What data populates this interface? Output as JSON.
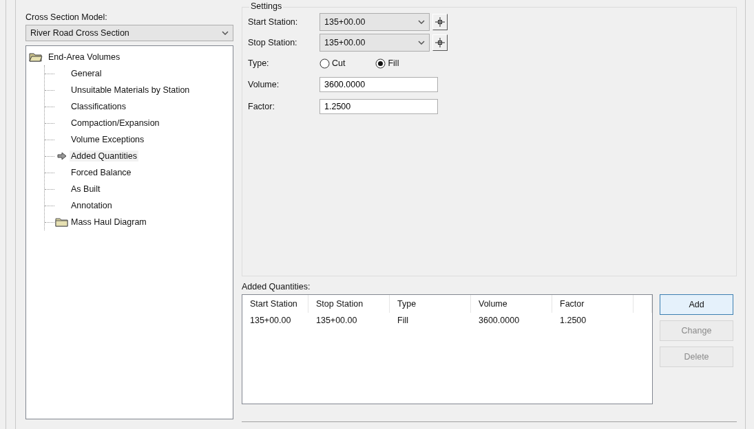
{
  "model": {
    "label": "Cross Section Model:",
    "value": "River Road Cross Section"
  },
  "tree": [
    {
      "label": "End-Area Volumes",
      "kind": "folder",
      "expanded": true,
      "children": [
        {
          "label": "General",
          "kind": "item",
          "selected": false
        },
        {
          "label": "Unsuitable Materials by Station",
          "kind": "item",
          "selected": false
        },
        {
          "label": "Classifications",
          "kind": "item",
          "selected": false
        },
        {
          "label": "Compaction/Expansion",
          "kind": "item",
          "selected": false
        },
        {
          "label": "Volume Exceptions",
          "kind": "item",
          "selected": false
        },
        {
          "label": "Added Quantities",
          "kind": "item",
          "selected": true
        },
        {
          "label": "Forced Balance",
          "kind": "item",
          "selected": false
        },
        {
          "label": "As Built",
          "kind": "item",
          "selected": false
        },
        {
          "label": "Annotation",
          "kind": "item",
          "selected": false
        },
        {
          "label": "Mass Haul Diagram",
          "kind": "folder",
          "expanded": false,
          "selected": false
        }
      ]
    }
  ],
  "settings": {
    "title": "Settings",
    "stations": [
      {
        "label": "Start Station:",
        "value": "135+00.00"
      },
      {
        "label": "Stop Station:",
        "value": "135+00.00"
      }
    ],
    "type": {
      "label": "Type:",
      "options": [
        {
          "label": "Cut",
          "selected": false
        },
        {
          "label": "Fill",
          "selected": true
        }
      ]
    },
    "fields": [
      {
        "label": "Volume:",
        "value": "3600.0000"
      },
      {
        "label": "Factor:",
        "value": "1.2500"
      }
    ]
  },
  "added_quantities": {
    "label": "Added Quantities:",
    "columns": [
      "Start Station",
      "Stop Station",
      "Type",
      "Volume",
      "Factor"
    ],
    "rows": [
      [
        "135+00.00",
        "135+00.00",
        "Fill",
        "3600.0000",
        "1.2500"
      ]
    ]
  },
  "buttons": [
    {
      "label": "Add",
      "disabled": false
    },
    {
      "label": "Change",
      "disabled": true
    },
    {
      "label": "Delete",
      "disabled": true
    }
  ]
}
